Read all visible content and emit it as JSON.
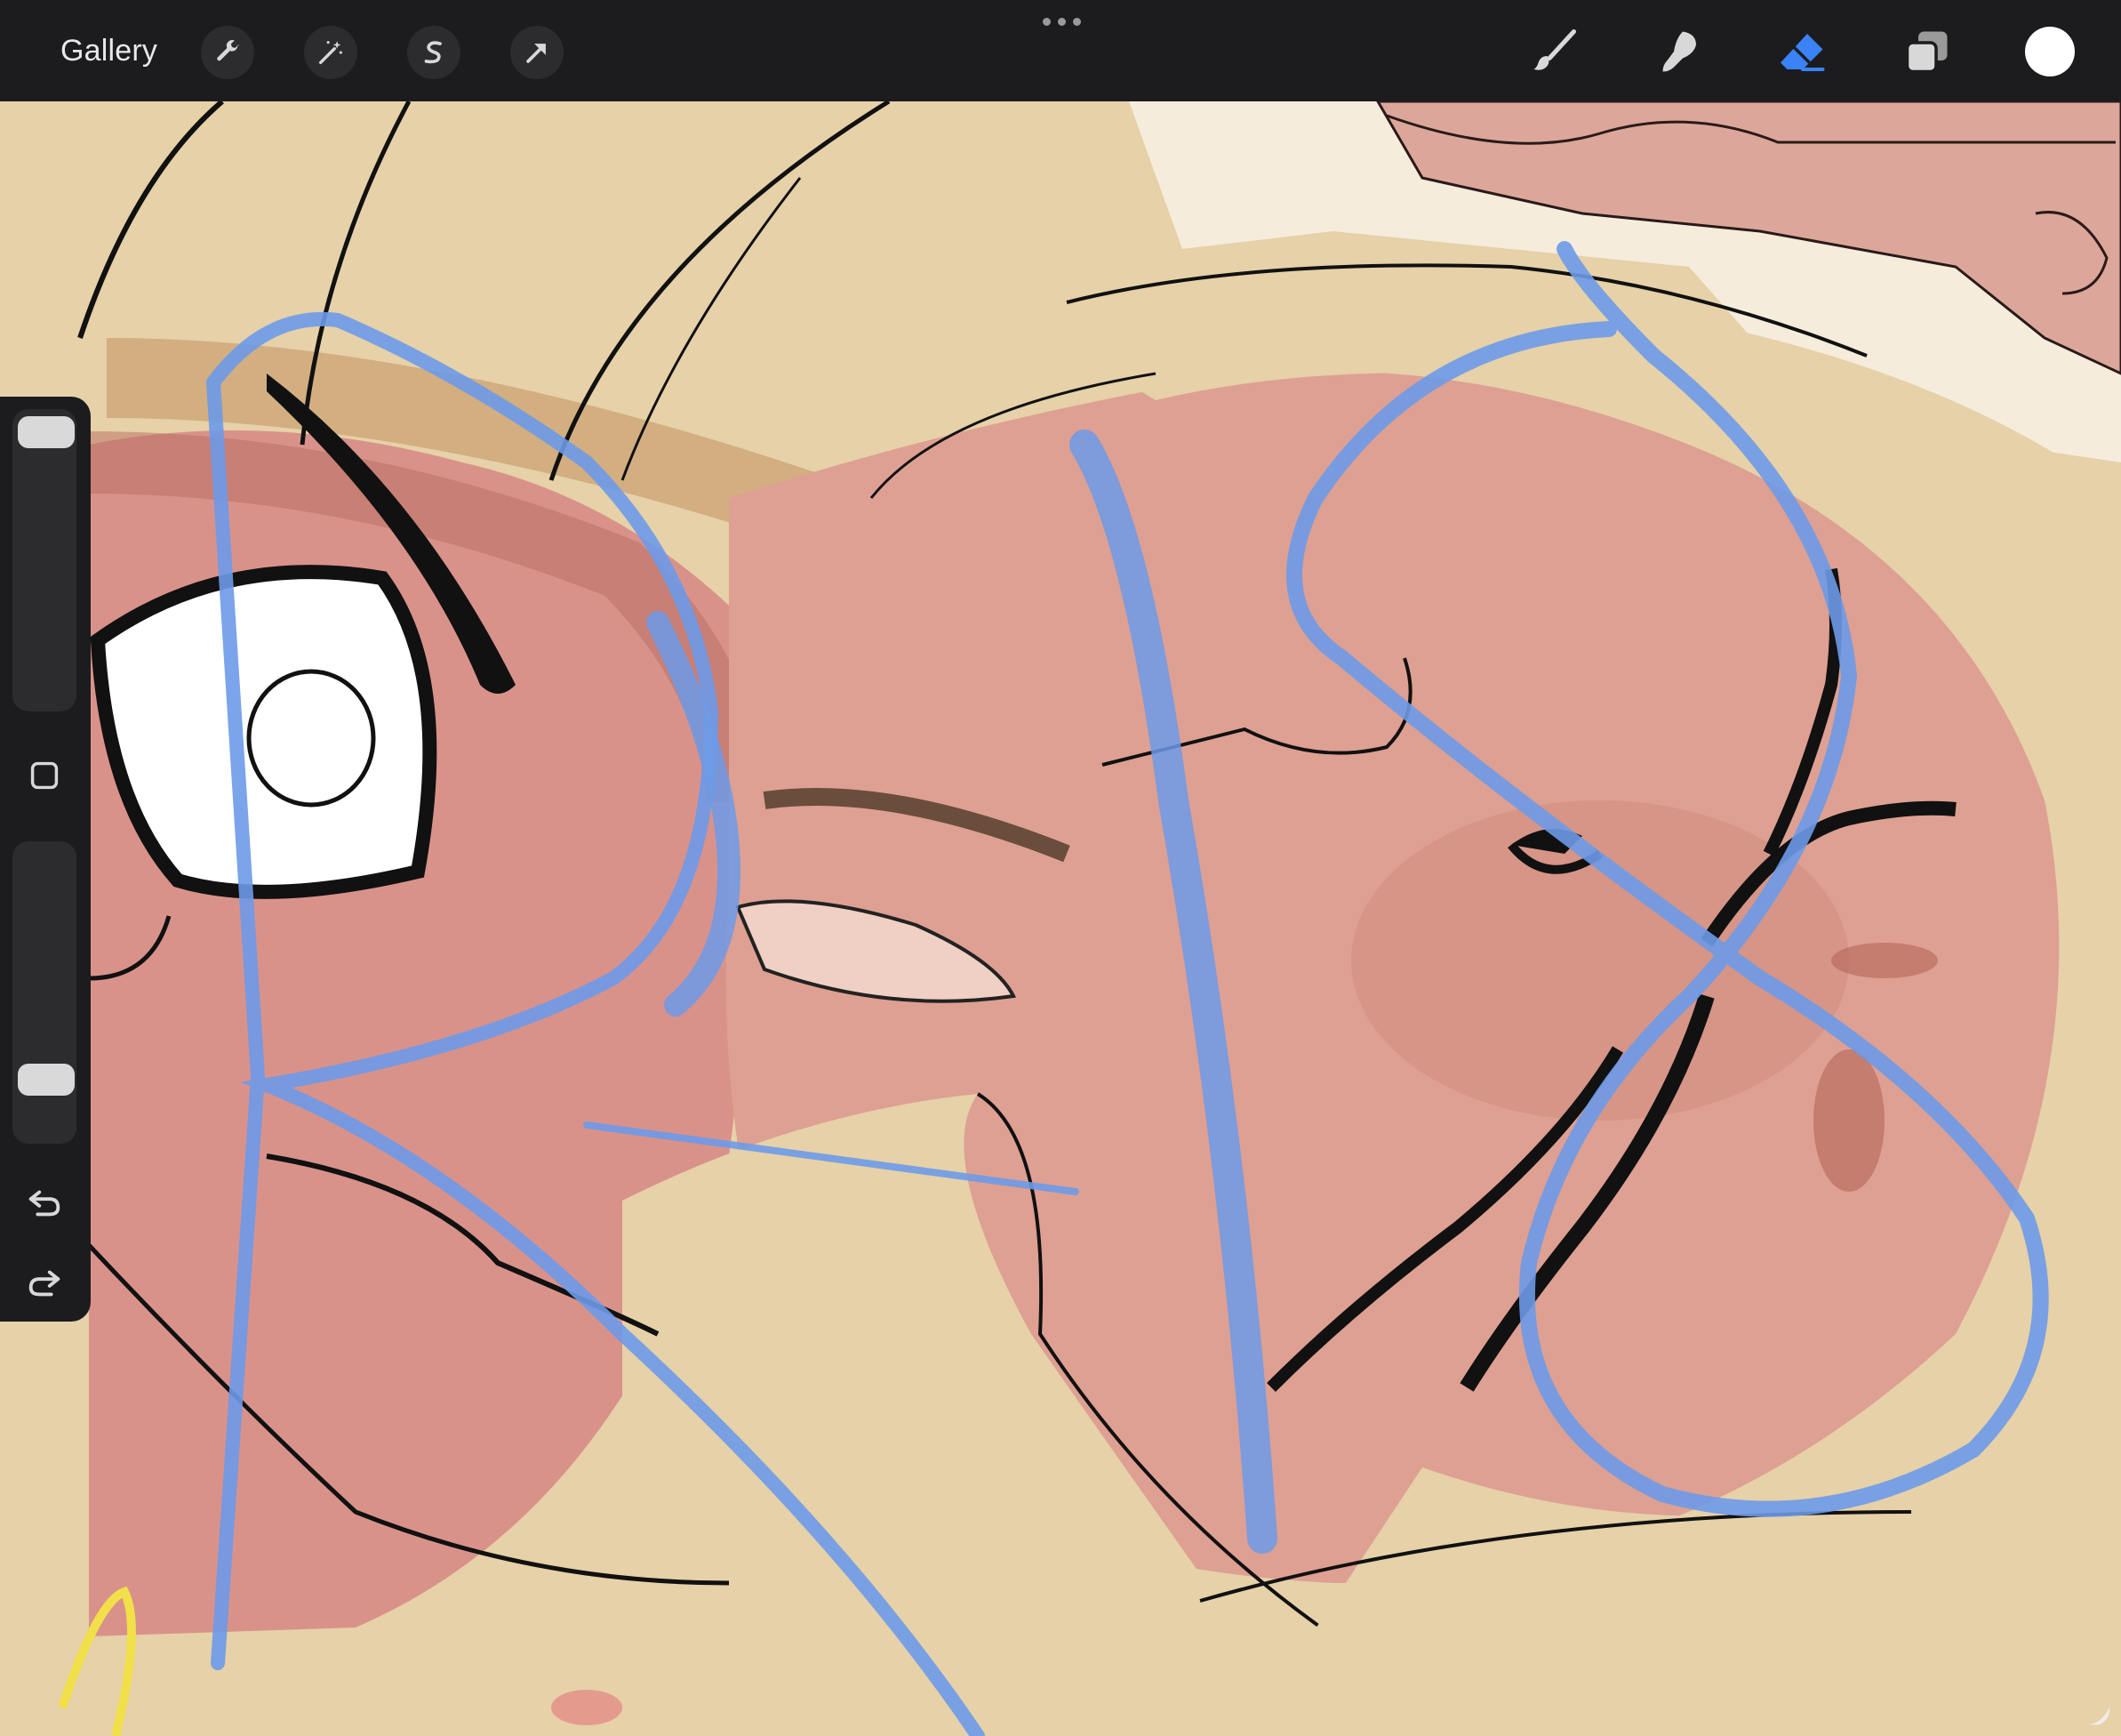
{
  "toolbar": {
    "gallery_label": "Gallery",
    "left_tools": [
      "wrench-icon",
      "magic-wand-icon",
      "selection-s-icon",
      "transform-arrow-icon"
    ],
    "right_tools": [
      "brush-icon",
      "smudge-icon",
      "eraser-icon",
      "layers-icon"
    ],
    "active_tool": "eraser-icon",
    "active_color_hex": "#3b82f6",
    "current_color": "#ffffff"
  },
  "sidebar": {
    "controls": [
      "brush-size-slider",
      "modify-button",
      "opacity-slider",
      "undo-button",
      "redo-button"
    ]
  },
  "canvas": {
    "background_colors": [
      "#e2cda5",
      "#d9928a",
      "#c97d72",
      "#7ea3e0"
    ]
  }
}
